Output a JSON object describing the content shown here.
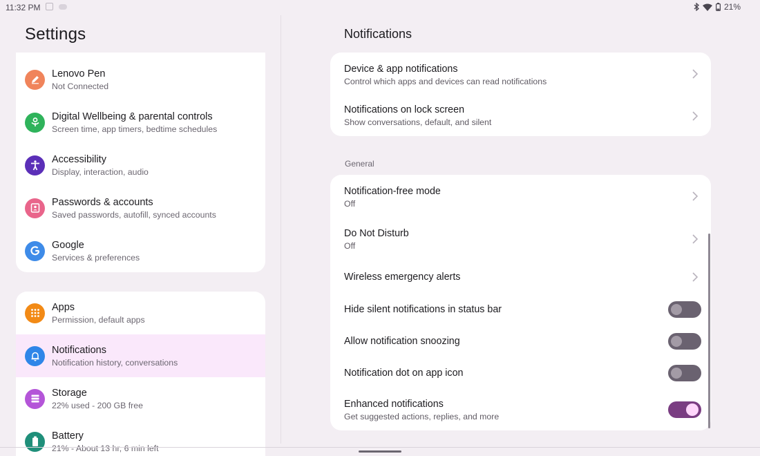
{
  "status_bar": {
    "time": "11:32 PM",
    "battery": "21%",
    "icons": [
      "gallery-icon",
      "cloud-icon",
      "bluetooth-icon",
      "wifi-icon",
      "battery-icon"
    ]
  },
  "left": {
    "title": "Settings",
    "group1": [
      {
        "title": "Lenovo Pen",
        "subtitle": "Not Connected",
        "icon": "pen-icon",
        "color": "#f0845b"
      },
      {
        "title": "Digital Wellbeing & parental controls",
        "subtitle": "Screen time, app timers, bedtime schedules",
        "icon": "wellbeing-icon",
        "color": "#2fb35b"
      },
      {
        "title": "Accessibility",
        "subtitle": "Display, interaction, audio",
        "icon": "accessibility-icon",
        "color": "#5b2fb8"
      },
      {
        "title": "Passwords & accounts",
        "subtitle": "Saved passwords, autofill, synced accounts",
        "icon": "account-icon",
        "color": "#e9658b"
      },
      {
        "title": "Google",
        "subtitle": "Services & preferences",
        "icon": "google-icon",
        "color": "#3e8be8"
      }
    ],
    "group2": [
      {
        "title": "Apps",
        "subtitle": "Permission, default apps",
        "icon": "apps-icon",
        "color": "#f28a16"
      },
      {
        "title": "Notifications",
        "subtitle": "Notification history, conversations",
        "icon": "bell-icon",
        "color": "#2f86e8",
        "active": true
      },
      {
        "title": "Storage",
        "subtitle": "22% used - 200 GB free",
        "icon": "storage-icon",
        "color": "#b455d8"
      },
      {
        "title": "Battery",
        "subtitle": "21% - About 13 hr, 6 min left",
        "icon": "battery-icon",
        "color": "#1f8f7a"
      }
    ]
  },
  "right": {
    "title": "Notifications",
    "group1": [
      {
        "title": "Device & app notifications",
        "subtitle": "Control which apps and devices can read notifications"
      },
      {
        "title": "Notifications on lock screen",
        "subtitle": "Show conversations, default, and silent"
      }
    ],
    "section_label": "General",
    "group2_nav": [
      {
        "title": "Notification-free mode",
        "subtitle": "Off"
      },
      {
        "title": "Do Not Disturb",
        "subtitle": "Off"
      },
      {
        "title": "Wireless emergency alerts"
      }
    ],
    "group2_toggles": [
      {
        "title": "Hide silent notifications in status bar",
        "on": false
      },
      {
        "title": "Allow notification snoozing",
        "on": false
      },
      {
        "title": "Notification dot on app icon",
        "on": false
      },
      {
        "title": "Enhanced notifications",
        "subtitle": "Get suggested actions, replies, and more",
        "on": true
      }
    ]
  }
}
